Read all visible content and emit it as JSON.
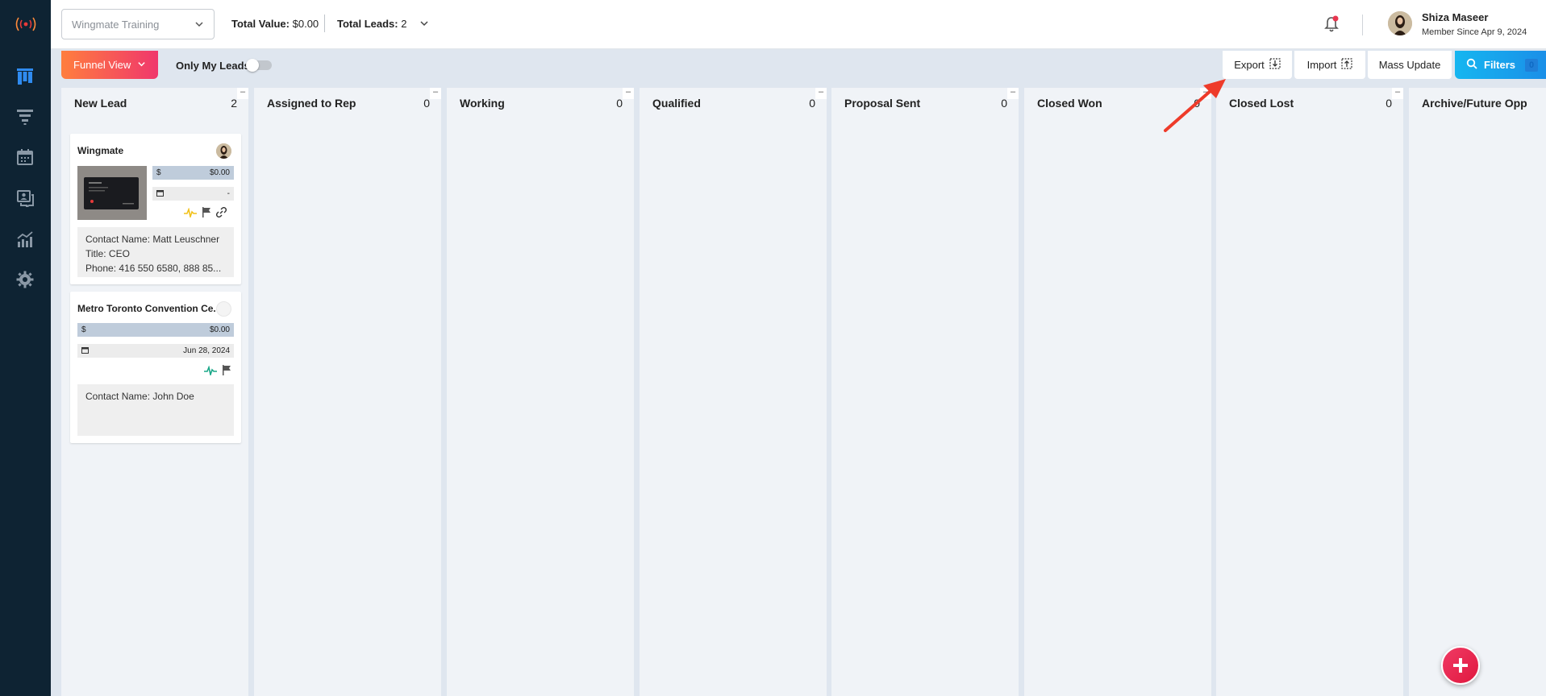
{
  "header": {
    "workspace": "Wingmate Training",
    "total_value_label": "Total Value:",
    "total_value": "$0.00",
    "total_leads_label": "Total Leads:",
    "total_leads": "2",
    "user": {
      "name": "Shiza Maseer",
      "since": "Member Since Apr 9, 2024"
    }
  },
  "toolbar": {
    "view": "Funnel View",
    "only_my_leads": "Only My Leads",
    "export": "Export",
    "import": "Import",
    "mass_update": "Mass Update",
    "filters": "Filters",
    "filters_count": "0"
  },
  "sidebar": {
    "items": [
      "board-icon",
      "funnel-icon",
      "calendar-icon",
      "contacts-chat-icon",
      "analytics-icon",
      "settings-icon"
    ]
  },
  "columns": [
    {
      "title": "New Lead",
      "count": "2"
    },
    {
      "title": "Assigned to Rep",
      "count": "0"
    },
    {
      "title": "Working",
      "count": "0"
    },
    {
      "title": "Qualified",
      "count": "0"
    },
    {
      "title": "Proposal Sent",
      "count": "0"
    },
    {
      "title": "Closed Won",
      "count": "0"
    },
    {
      "title": "Closed Lost",
      "count": "0"
    },
    {
      "title": "Archive/Future Opp",
      "count": ""
    }
  ],
  "cards": [
    {
      "title": "Wingmate",
      "currency": "$",
      "value": "$0.00",
      "date": "-",
      "contact_name_label": "Contact Name:",
      "contact_name": "Matt Leuschner",
      "title_label": "Title:",
      "contact_title": "CEO",
      "phone_label": "Phone:",
      "phone": "416 550 6580, 888 85..."
    },
    {
      "title": "Metro Toronto Convention Ce...",
      "currency": "$",
      "value": "$0.00",
      "date": "Jun 28, 2024",
      "contact_name_label": "Contact Name:",
      "contact_name": "John Doe"
    }
  ],
  "colors": {
    "sidebar": "#0e2333",
    "accent_gradient_start": "#ff7e3e",
    "accent_gradient_end": "#f0376c",
    "filters_blue": "#16b6f0",
    "fab_red": "#e0183f"
  }
}
